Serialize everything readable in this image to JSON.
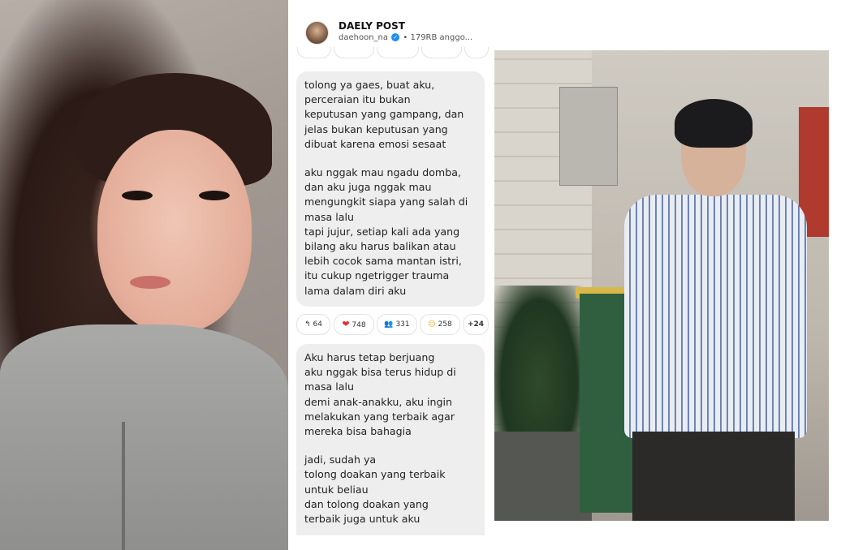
{
  "post": {
    "channel_name": "DAELY POST",
    "handle": "daehoon_na",
    "members": "• 179RB anggo...",
    "message1": {
      "paragraphs": [
        "tolong ya gaes, buat aku,\nperceraian itu bukan\nkeputusan yang gampang, dan\njelas bukan keputusan yang\ndibuat karena emosi sesaat",
        "aku nggak mau ngadu domba,\ndan aku juga nggak mau\nmengungkit siapa yang salah di\nmasa lalu\ntapi jujur, setiap kali ada yang\nbilang aku harus balikan atau\nlebih cocok sama mantan istri,\nitu cukup ngetrigger trauma\nlama dalam diri aku"
      ]
    },
    "reactions": [
      {
        "icon": "reply-icon",
        "glyph": "↰",
        "count": "64"
      },
      {
        "icon": "heart-icon",
        "glyph": "❤",
        "count": "748"
      },
      {
        "icon": "hands-icon",
        "glyph": "🙏",
        "count": "331"
      },
      {
        "icon": "sad-face-icon",
        "glyph": "😢",
        "count": "258"
      },
      {
        "icon": "more-reactions",
        "glyph": "",
        "count": "+24"
      }
    ],
    "message2": {
      "paragraphs": [
        "Aku harus tetap berjuang\naku nggak bisa terus hidup di\nmasa lalu\ndemi anak-anakku, aku ingin\nmelakukan yang terbaik agar\nmereka bisa bahagia",
        "jadi, sudah ya\ntolong doakan yang terbaik\nuntuk beliau\ndan tolong doakan yang\nterbaik juga untuk aku"
      ]
    }
  }
}
